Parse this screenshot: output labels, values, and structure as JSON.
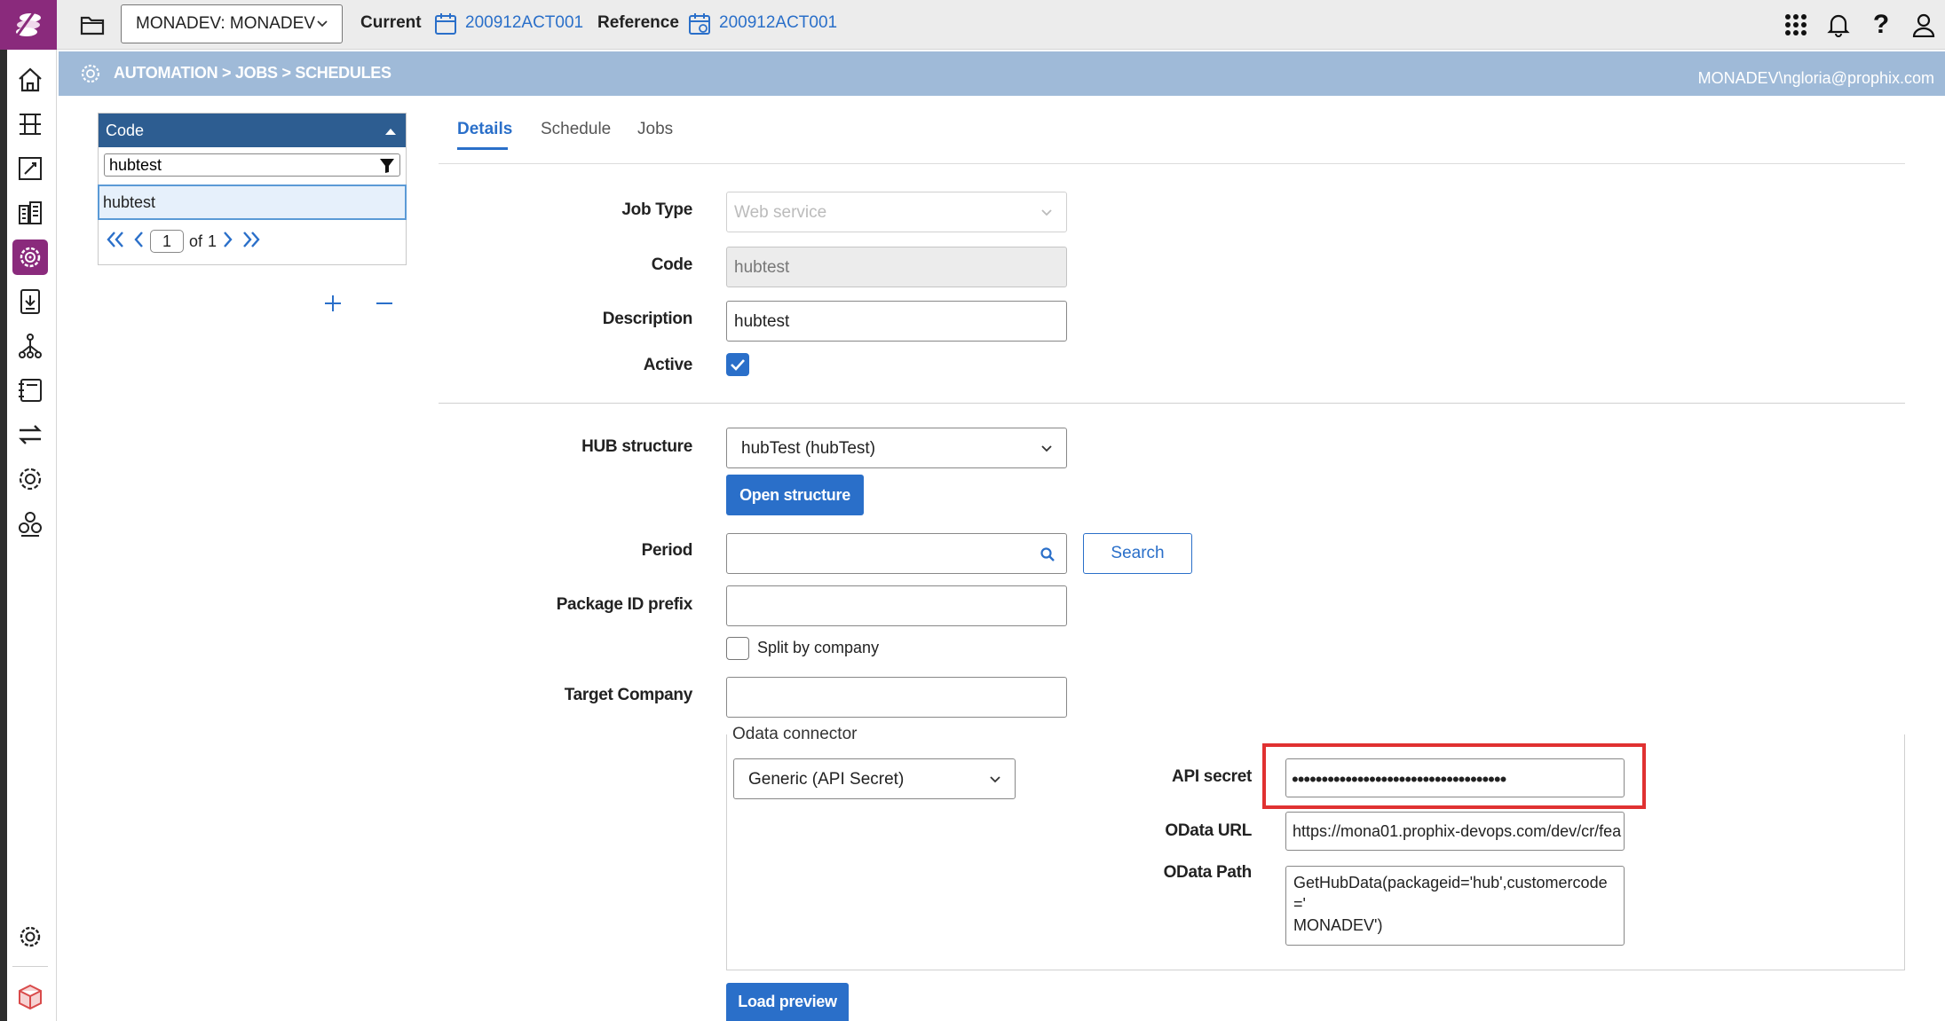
{
  "topbar": {
    "environment": "MONADEV: MONADEV",
    "current_label": "Current",
    "current_value": "200912ACT001",
    "reference_label": "Reference",
    "reference_value": "200912ACT001"
  },
  "breadcrumb": "AUTOMATION > JOBS > SCHEDULES",
  "user": "MONADEV\\ngloria@prophix.com",
  "grid": {
    "column_header": "Code",
    "filter_value": "hubtest",
    "rows": [
      "hubtest"
    ],
    "pager": {
      "page": "1",
      "of_label": "of",
      "total": "1"
    }
  },
  "tabs": [
    "Details",
    "Schedule",
    "Jobs"
  ],
  "form": {
    "job_type_label": "Job Type",
    "job_type_value": "Web service",
    "code_label": "Code",
    "code_value": "hubtest",
    "description_label": "Description",
    "description_value": "hubtest",
    "active_label": "Active",
    "active_checked": true,
    "hub_structure_label": "HUB structure",
    "hub_structure_value": "hubTest (hubTest)",
    "open_structure_button": "Open structure",
    "period_label": "Period",
    "period_value": "",
    "search_button": "Search",
    "package_id_prefix_label": "Package ID prefix",
    "package_id_prefix_value": "",
    "split_by_company_label": "Split by company",
    "split_by_company_checked": false,
    "target_company_label": "Target Company",
    "target_company_value": "",
    "odata_group_title": "Odata connector",
    "connector_value": "Generic (API Secret)",
    "api_secret_label": "API secret",
    "api_secret_value": "••••••••••••••••••••••••••••••••••••",
    "odata_url_label": "OData URL",
    "odata_url_value": "https://mona01.prophix-devops.com/dev/cr/fea",
    "odata_path_label": "OData Path",
    "odata_path_value": "GetHubData(packageid='hub',customercode='\nMONADEV')",
    "load_preview_button": "Load preview"
  },
  "colors": {
    "brand": "#8a2a7c",
    "accent": "#2a6fc9",
    "header_bar": "#9fbad8",
    "grid_header": "#2d5d91",
    "highlight": "#e03131"
  },
  "icons": {
    "nav": [
      "home-icon",
      "structure-icon",
      "edit-sheet-icon",
      "buildings-icon",
      "automation-icon",
      "document-download-icon",
      "hierarchy-icon",
      "notebook-icon",
      "transfer-icon",
      "settings-group-icon",
      "workflow-icon",
      "gear-icon",
      "cube-icon"
    ],
    "top": [
      "apps-grid-icon",
      "bell-icon",
      "help-icon",
      "user-icon"
    ]
  }
}
